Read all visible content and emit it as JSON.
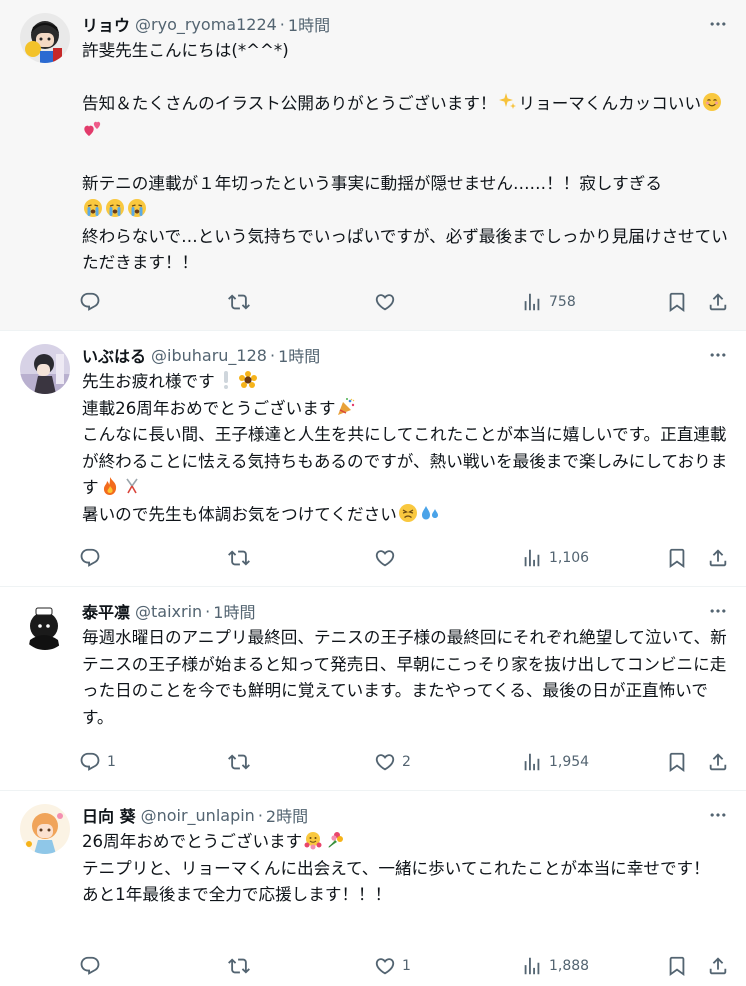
{
  "tweets": [
    {
      "name": "リョウ",
      "handle": "@ryo_ryoma1224",
      "time": "1時間",
      "text_a": "許斐先生こんにちは(*^^*)\n\n告知＆たくさんのイラスト公開ありがとうございます！",
      "text_b": "リョーマくんカッコいい",
      "text_c": "\n\n新テニの連載が１年切ったという事実に動揺が隠せません……！！寂しすぎる\n",
      "text_d": "\n終わらないで…という気持ちでいっぱいですが、必ず最後までしっかり見届けさせていただきます！！",
      "replies": "",
      "retweets": "",
      "likes": "",
      "views": "758"
    },
    {
      "name": "いぶはる",
      "handle": "@ibuharu_128",
      "time": "1時間",
      "text_a": "先生お疲れ様です",
      "text_b": "\n連載26周年おめでとうございます",
      "text_c": "\nこんなに長い間、王子様達と人生を共にしてこれたことが本当に嬉しいです。正直連載が終わることに怯える気持ちもあるのですが、熱い戦いを最後まで楽しみにしております",
      "text_d": "\n暑いので先生も体調お気をつけてください",
      "replies": "",
      "retweets": "",
      "likes": "",
      "views": "1,106"
    },
    {
      "name": "泰平凛",
      "handle": "@taixrin",
      "time": "1時間",
      "text_a": "毎週水曜日のアニプリ最終回、テニスの王子様の最終回にそれぞれ絶望して泣いて、新テニスの王子様が始まると知って発売日、早朝にこっそり家を抜け出してコンビニに走った日のことを今でも鮮明に覚えています。またやってくる、最後の日が正直怖いです。",
      "replies": "1",
      "retweets": "",
      "likes": "2",
      "views": "1,954"
    },
    {
      "name": "日向 葵",
      "handle": "@noir_unlapin",
      "time": "2時間",
      "text_a": "26周年おめでとうございます",
      "text_b": "\nテニプリと、リョーマくんに出会えて、一緒に歩いてこれたことが本当に幸せです！\nあと1年最後まで全力で応援します！！！",
      "replies": "",
      "retweets": "",
      "likes": "1",
      "views": "1,888"
    }
  ],
  "ui": {
    "dot": "·",
    "colors": {
      "text": "#0f1419",
      "muted": "#536471",
      "highlight_bg": "#f7f7f7",
      "divider": "#eff3f4"
    },
    "icons": [
      "reply-icon",
      "retweet-icon",
      "like-icon",
      "views-icon",
      "bookmark-icon",
      "share-icon",
      "more-icon"
    ]
  }
}
